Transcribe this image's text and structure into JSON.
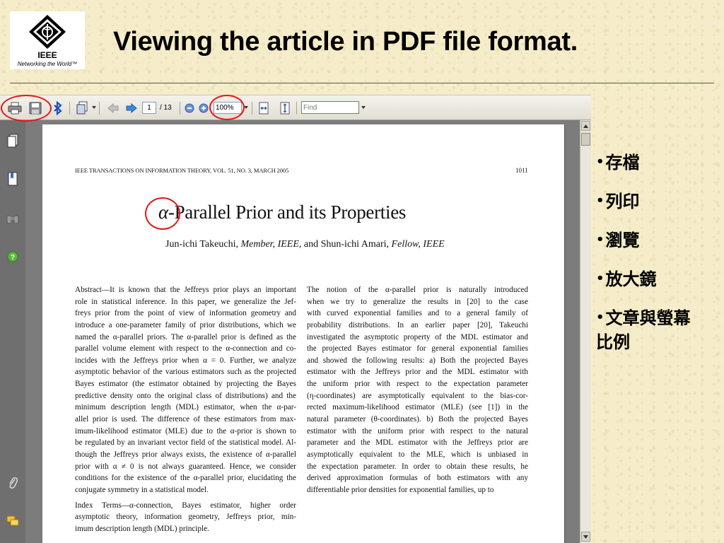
{
  "slide": {
    "title": "Viewing the article in PDF file format.",
    "logo": {
      "word": "IEEE",
      "tagline": "Networking the World™"
    }
  },
  "toolbar": {
    "page_current": "1",
    "page_total": "/ 13",
    "zoom": "100%",
    "find_placeholder": "Find"
  },
  "paper": {
    "journal_header": "IEEE TRANSACTIONS ON INFORMATION THEORY, VOL. 51, NO. 3, MARCH 2005",
    "page_number": "1011",
    "title_alpha": "α",
    "title_rest": "-Parallel Prior and its Properties",
    "authors_a": "Jun-ichi Takeuchi, ",
    "authors_a_role": "Member, IEEE,",
    "authors_mid": " and Shun-ichi Amari, ",
    "authors_b_role": "Fellow, IEEE",
    "left_lines": [
      "Abstract—It is known that the Jeffreys prior plays an important",
      "role in statistical inference. In this paper, we generalize the Jef-",
      "freys prior from the point of view of information geometry and",
      "introduce a one-parameter family of prior distributions, which we",
      "named the α-parallel priors. The α-parallel prior is defined as the",
      "parallel volume element with respect to the α-connection and co-",
      "incides with the Jeffreys prior when α = 0. Further, we analyze",
      "asymptotic behavior of the various estimators such as the projected",
      "Bayes estimator (the estimator obtained by projecting the Bayes",
      "predictive density onto the original class of distributions) and the",
      "minimum description length (MDL) estimator, when the α-par-",
      "allel prior is used. The difference of these estimators from max-",
      "imum-likelihood estimator (MLE) due to the α-prior is shown to",
      "be regulated by an invariant vector field of the statistical model. Al-",
      "though the Jeffreys prior always exists, the existence of α-parallel",
      "prior with α ≠ 0 is not always guaranteed. Hence, we consider",
      "conditions for the existence of the α-parallel prior, elucidating the",
      "conjugate symmetry in a statistical model."
    ],
    "index_lines": [
      "Index Terms—α-connection, Bayes estimator, higher order",
      "asymptotic theory, information geometry, Jeffreys prior, min-",
      "imum description length (MDL) principle."
    ],
    "right_lines": [
      "The notion of the α-parallel prior is naturally introduced",
      "when we try to generalize the results in [20] to the case",
      "with curved exponential families and to a general family of",
      "probability distributions. In an earlier paper [20], Takeuchi",
      "investigated the asymptotic property of the MDL estimator and",
      "the projected Bayes estimator for general exponential families",
      "and showed the following results: a) Both the projected Bayes",
      "estimator with the Jeffreys prior and the MDL estimator with",
      "the uniform prior with respect to the expectation parameter",
      "(η-coordinates) are asymptotically equivalent to the bias-cor-",
      "rected maximum-likelihood estimator (MLE) (see [1]) in the",
      "natural parameter (θ-coordinates). b) Both the projected Bayes",
      "estimator with the uniform prior with respect to the natural",
      "parameter and the MDL estimator with the Jeffreys prior are",
      "asymptotically equivalent to the MLE, which is unbiased in",
      "the expectation parameter. In order to obtain these results, he",
      "derived approximation formulas of both estimators with any",
      "differentiable prior densities for exponential families, up to"
    ]
  },
  "bullets": [
    "存檔",
    "列印",
    "瀏覽",
    "放大鏡",
    "文章與螢幕比例"
  ],
  "colors": {
    "annotation_ring": "#e01818",
    "slide_background": "#f5ecc9"
  }
}
